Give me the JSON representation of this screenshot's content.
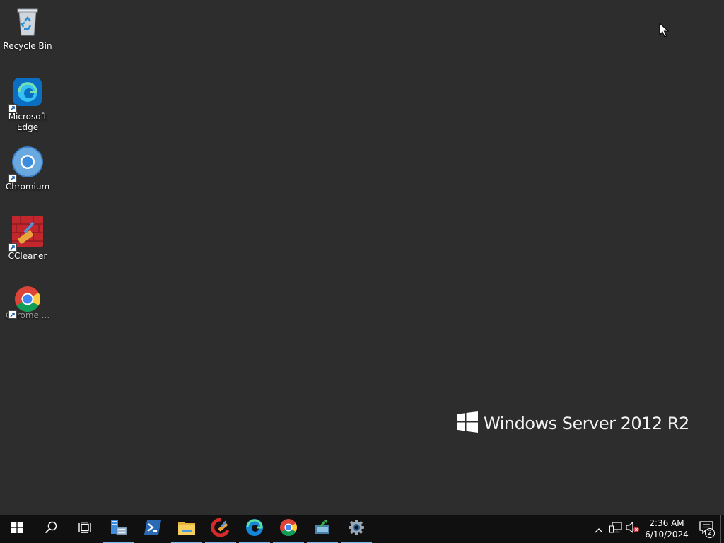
{
  "desktop": {
    "icons": [
      {
        "label": "Recycle Bin",
        "icon": "recycle-bin-icon"
      },
      {
        "label": "Microsoft Edge",
        "icon": "edge-icon"
      },
      {
        "label": "Chromium",
        "icon": "chromium-icon"
      },
      {
        "label": "CCleaner",
        "icon": "ccleaner-icon"
      },
      {
        "label": "Chrome ...",
        "icon": "chrome-icon"
      }
    ],
    "watermark": "Windows Server 2012 R2"
  },
  "taskbar": {
    "items": [
      {
        "name": "start",
        "icon": "windows-logo-icon"
      },
      {
        "name": "search",
        "icon": "search-icon"
      },
      {
        "name": "task-view",
        "icon": "task-view-icon"
      },
      {
        "name": "server-manager",
        "icon": "server-manager-icon"
      },
      {
        "name": "powershell",
        "icon": "powershell-icon"
      },
      {
        "name": "file-explorer",
        "icon": "folder-icon"
      },
      {
        "name": "ccleaner",
        "icon": "ccleaner-icon"
      },
      {
        "name": "edge",
        "icon": "edge-icon"
      },
      {
        "name": "chrome",
        "icon": "chrome-icon"
      },
      {
        "name": "app",
        "icon": "green-arrow-app-icon"
      },
      {
        "name": "settings",
        "icon": "gear-icon"
      }
    ],
    "clock": {
      "time": "2:36 AM",
      "date": "6/10/2024"
    },
    "notification_count": "2"
  },
  "colors": {
    "desktop_bg": "#2d2d2d",
    "taskbar_bg": "#101010",
    "running_indicator": "#76b9ed"
  }
}
